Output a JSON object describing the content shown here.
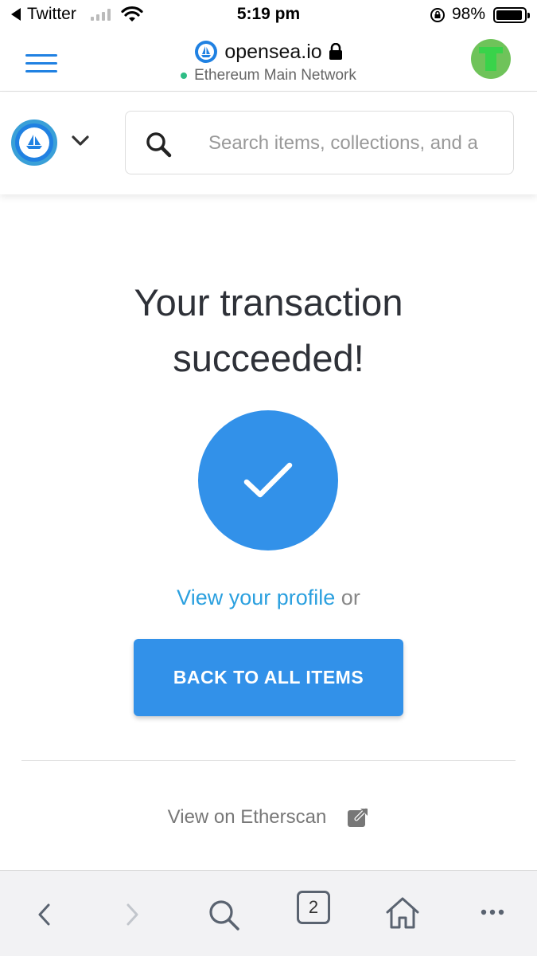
{
  "status_bar": {
    "back_app": "Twitter",
    "time": "5:19 pm",
    "battery": "98%"
  },
  "address_bar": {
    "domain": "opensea.io",
    "network": "Ethereum Main Network"
  },
  "search": {
    "placeholder": "Search items, collections, and a"
  },
  "main": {
    "title_line1": "Your transaction",
    "title_line2": "succeeded!",
    "profile_link": "View your profile",
    "or_text": "or",
    "back_button": "BACK TO ALL ITEMS",
    "etherscan_link": "View on Etherscan"
  },
  "toolbar": {
    "tab_count": "2"
  },
  "colors": {
    "accent": "#3291e9",
    "link": "#2ba0df",
    "network_dot": "#2ebd85"
  }
}
